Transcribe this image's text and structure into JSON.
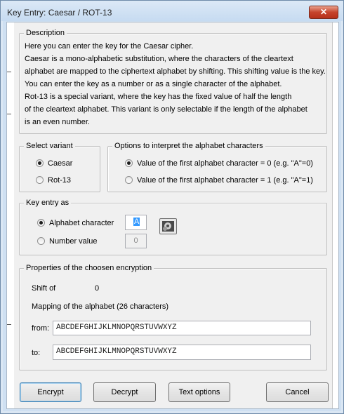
{
  "window": {
    "title": "Key Entry: Caesar / ROT-13",
    "close_label": "✕"
  },
  "description": {
    "legend": "Description",
    "lines": [
      "Here you can enter the key for the Caesar cipher.",
      "Caesar is a mono-alphabetic substitution, where the characters of the cleartext",
      "alphabet are mapped to the ciphertext alphabet by shifting. This shifting value is the key.",
      "You can enter the key as a number or as a single character of the alphabet.",
      "Rot-13 is a special variant, where the key has the fixed value of half the length",
      "of the cleartext alphabet. This variant is only selectable if the length of the alphabet",
      "is an even number."
    ]
  },
  "variant": {
    "legend": "Select variant",
    "options": [
      {
        "label": "Caesar",
        "selected": true
      },
      {
        "label": "Rot-13",
        "selected": false
      }
    ]
  },
  "interpret": {
    "legend": "Options to interpret the alphabet characters",
    "options": [
      {
        "label": "Value of the first alphabet character = 0 (e.g. \"A\"=0)",
        "selected": true
      },
      {
        "label": "Value of the first alphabet character = 1 (e.g. \"A\"=1)",
        "selected": false
      }
    ]
  },
  "key_entry": {
    "legend": "Key entry as",
    "alpha_label": "Alphabet character",
    "alpha_value": "A",
    "alpha_selected": true,
    "number_label": "Number value",
    "number_value": "0",
    "number_selected": false,
    "picker_icon": "gear-icon"
  },
  "properties": {
    "legend": "Properties of the choosen encryption",
    "shift_label": "Shift of",
    "shift_value": "0",
    "mapping_label": "Mapping of the alphabet (26 characters)",
    "from_label": "from:",
    "from_value": "ABCDEFGHIJKLMNOPQRSTUVWXYZ",
    "to_label": "to:",
    "to_value": "ABCDEFGHIJKLMNOPQRSTUVWXYZ"
  },
  "buttons": {
    "encrypt": "Encrypt",
    "decrypt": "Decrypt",
    "text_options": "Text options",
    "cancel": "Cancel"
  }
}
